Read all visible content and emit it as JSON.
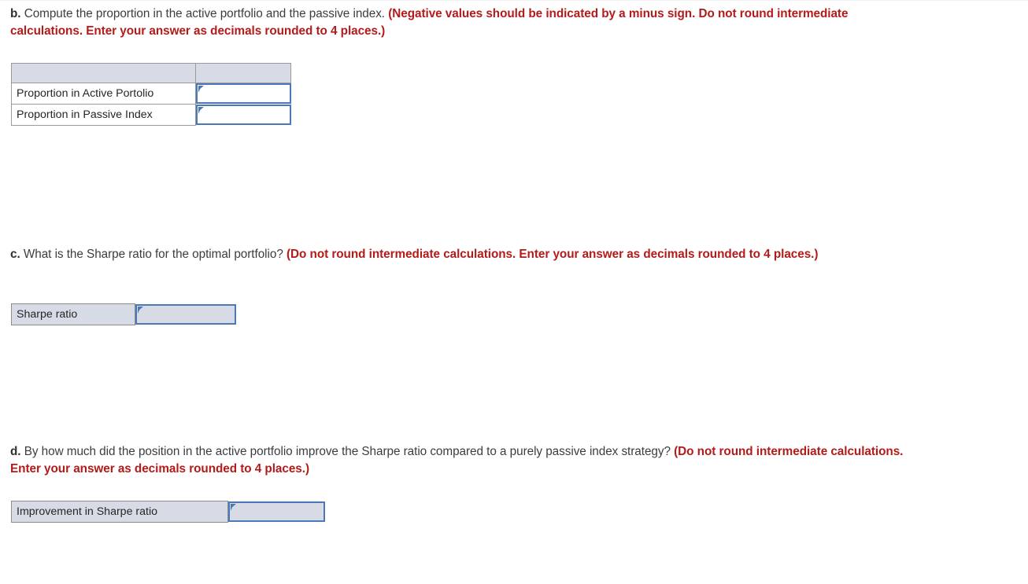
{
  "page": {
    "background": "#ffffff",
    "body_text_color": "#3d3d3d",
    "emphasis_color": "#b31b1b",
    "field_border_color": "#4a79b5",
    "field_tint_color": "#d7dbe6",
    "table_border_color": "#9a9a9a"
  },
  "questions": {
    "b": {
      "letter": "b.",
      "prompt": " Compute the proportion in the active portfolio and the passive index. ",
      "instruction": "(Negative values should be indicated by a minus sign. Do not round intermediate calculations. Enter your answer as decimals rounded to 4 places.)"
    },
    "c": {
      "letter": "c.",
      "prompt": " What is the Sharpe ratio for the optimal portfolio? ",
      "instruction": "(Do not round intermediate calculations. Enter your answer as decimals rounded to 4 places.)"
    },
    "d": {
      "letter": "d.",
      "prompt": " By how much did the position in the active portfolio improve the Sharpe ratio compared to a purely passive index strategy? ",
      "instruction": "(Do not round intermediate calculations. Enter your answer as decimals rounded to 4 places.)"
    }
  },
  "tables": {
    "proportions": {
      "header": {
        "left": "",
        "right": ""
      },
      "rows": [
        {
          "label": "Proportion in Active Portolio",
          "value": "",
          "placeholder": ""
        },
        {
          "label": "Proportion in Passive Index",
          "value": "",
          "placeholder": ""
        }
      ]
    },
    "sharpe": {
      "rows": [
        {
          "label": "Sharpe ratio",
          "value": "",
          "placeholder": ""
        }
      ]
    },
    "improvement": {
      "rows": [
        {
          "label": "Improvement in Sharpe ratio",
          "value": "",
          "placeholder": ""
        }
      ]
    }
  }
}
